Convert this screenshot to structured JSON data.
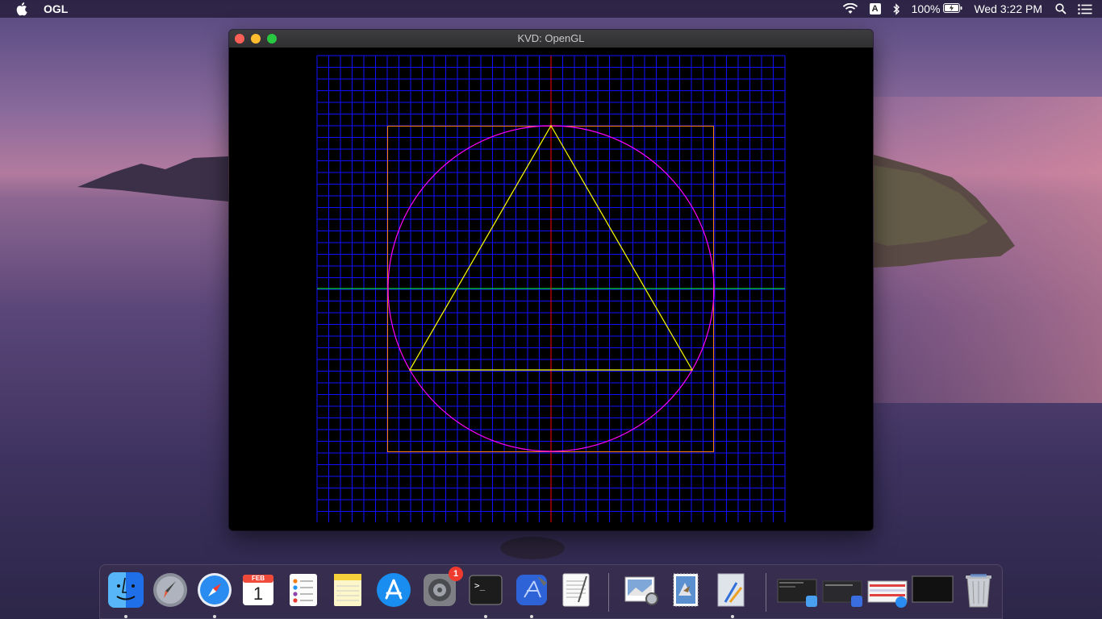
{
  "menubar": {
    "app_name": "OGL",
    "input_source": "A",
    "battery": "100%",
    "clock": "Wed 3:22 PM"
  },
  "window": {
    "title": "KVD: OpenGL"
  },
  "dock": {
    "calendar_month": "FEB",
    "calendar_day": "1",
    "system_prefs_badge": "1",
    "terminal_prompt": ">_"
  },
  "colors": {
    "grid": "#1010ff",
    "x_axis": "#00ff00",
    "y_axis": "#ff0000",
    "square": "#ff8000",
    "circle": "#ff00ff",
    "triangle": "#ffff00"
  }
}
